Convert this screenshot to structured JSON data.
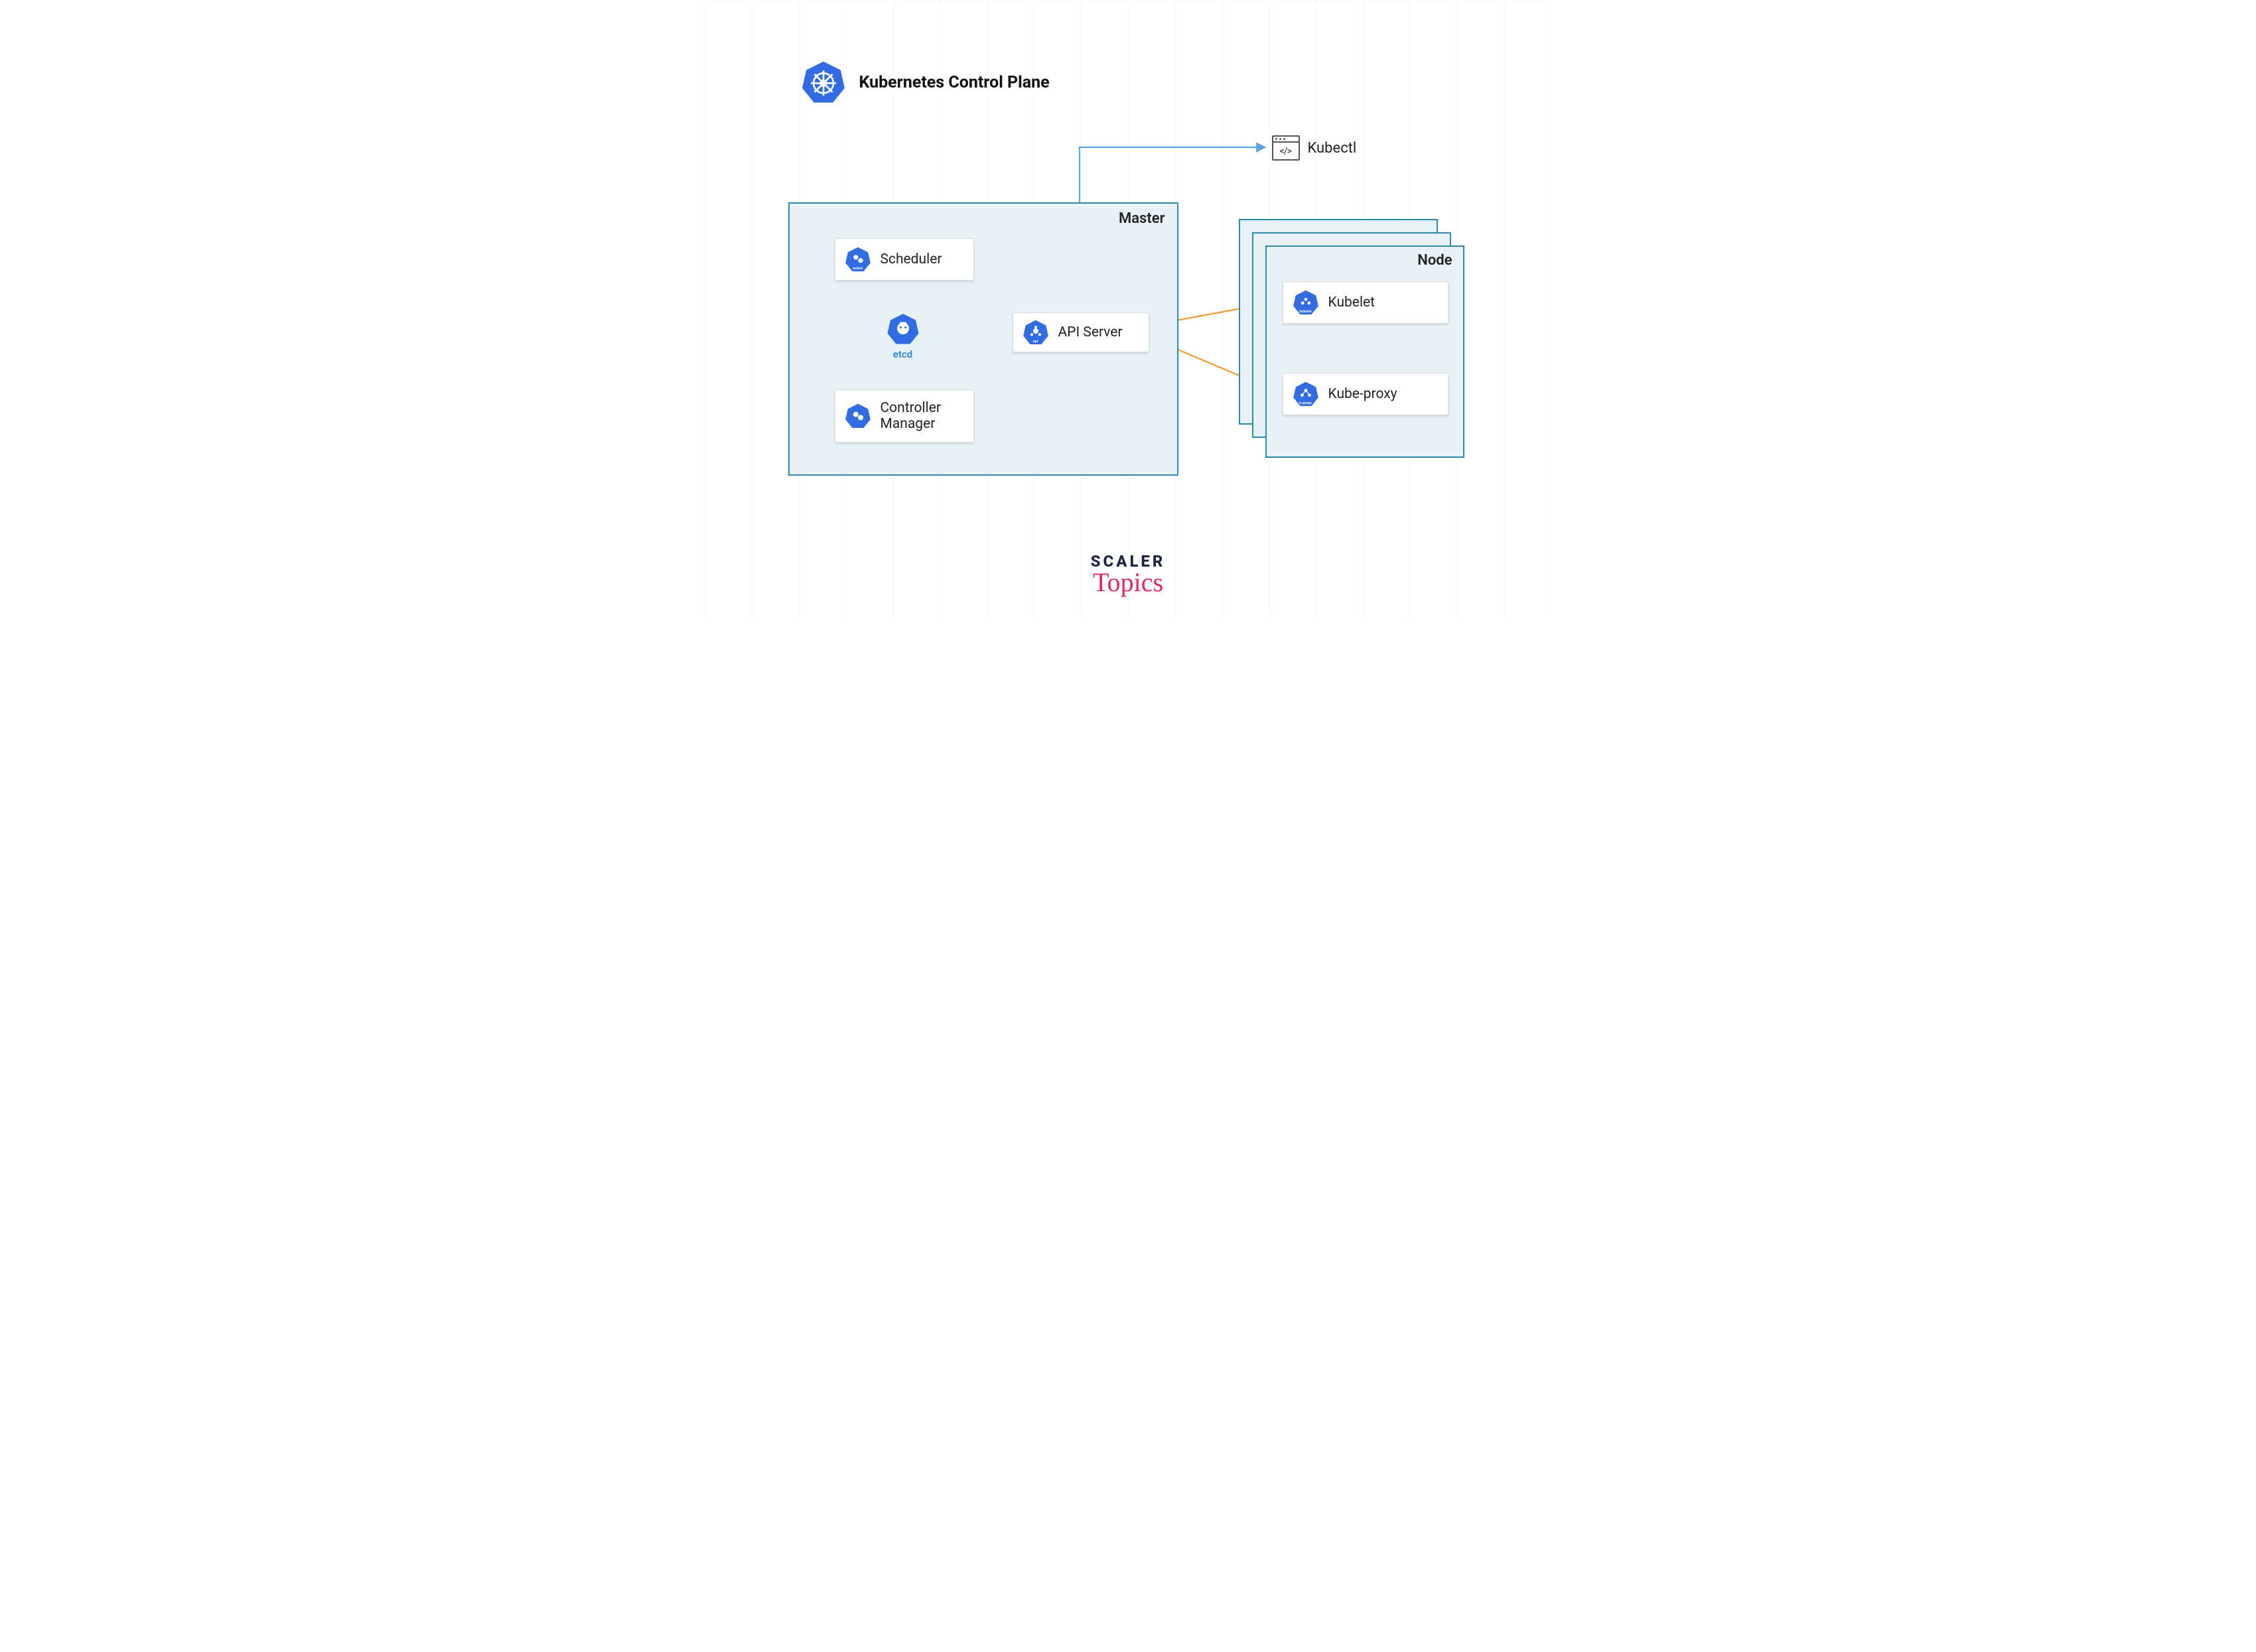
{
  "title": "Kubernetes Control Plane",
  "master": {
    "label": "Master",
    "scheduler": {
      "label": "Scheduler",
      "icon_sub": "sched"
    },
    "etcd": {
      "label": "etcd"
    },
    "api_server": {
      "label": "API Server",
      "icon_sub": "api"
    },
    "controller_manager": {
      "label": "Controller\nManager"
    }
  },
  "kubectl": {
    "label": "Kubectl"
  },
  "node": {
    "label": "Node",
    "kubelet": {
      "label": "Kubelet",
      "icon_sub": "kubelet"
    },
    "kube_proxy": {
      "label": "Kube-proxy",
      "icon_sub": "k-proxy"
    }
  },
  "brand": {
    "line1": "SCALER",
    "line2": "Topics"
  },
  "colors": {
    "blue": "#3b82d6",
    "arrow_blue": "#5aa7e0",
    "arrow_orange": "#f59a2d",
    "panel_bg": "#e6f2f5",
    "panel_border": "#2b8aa8"
  }
}
